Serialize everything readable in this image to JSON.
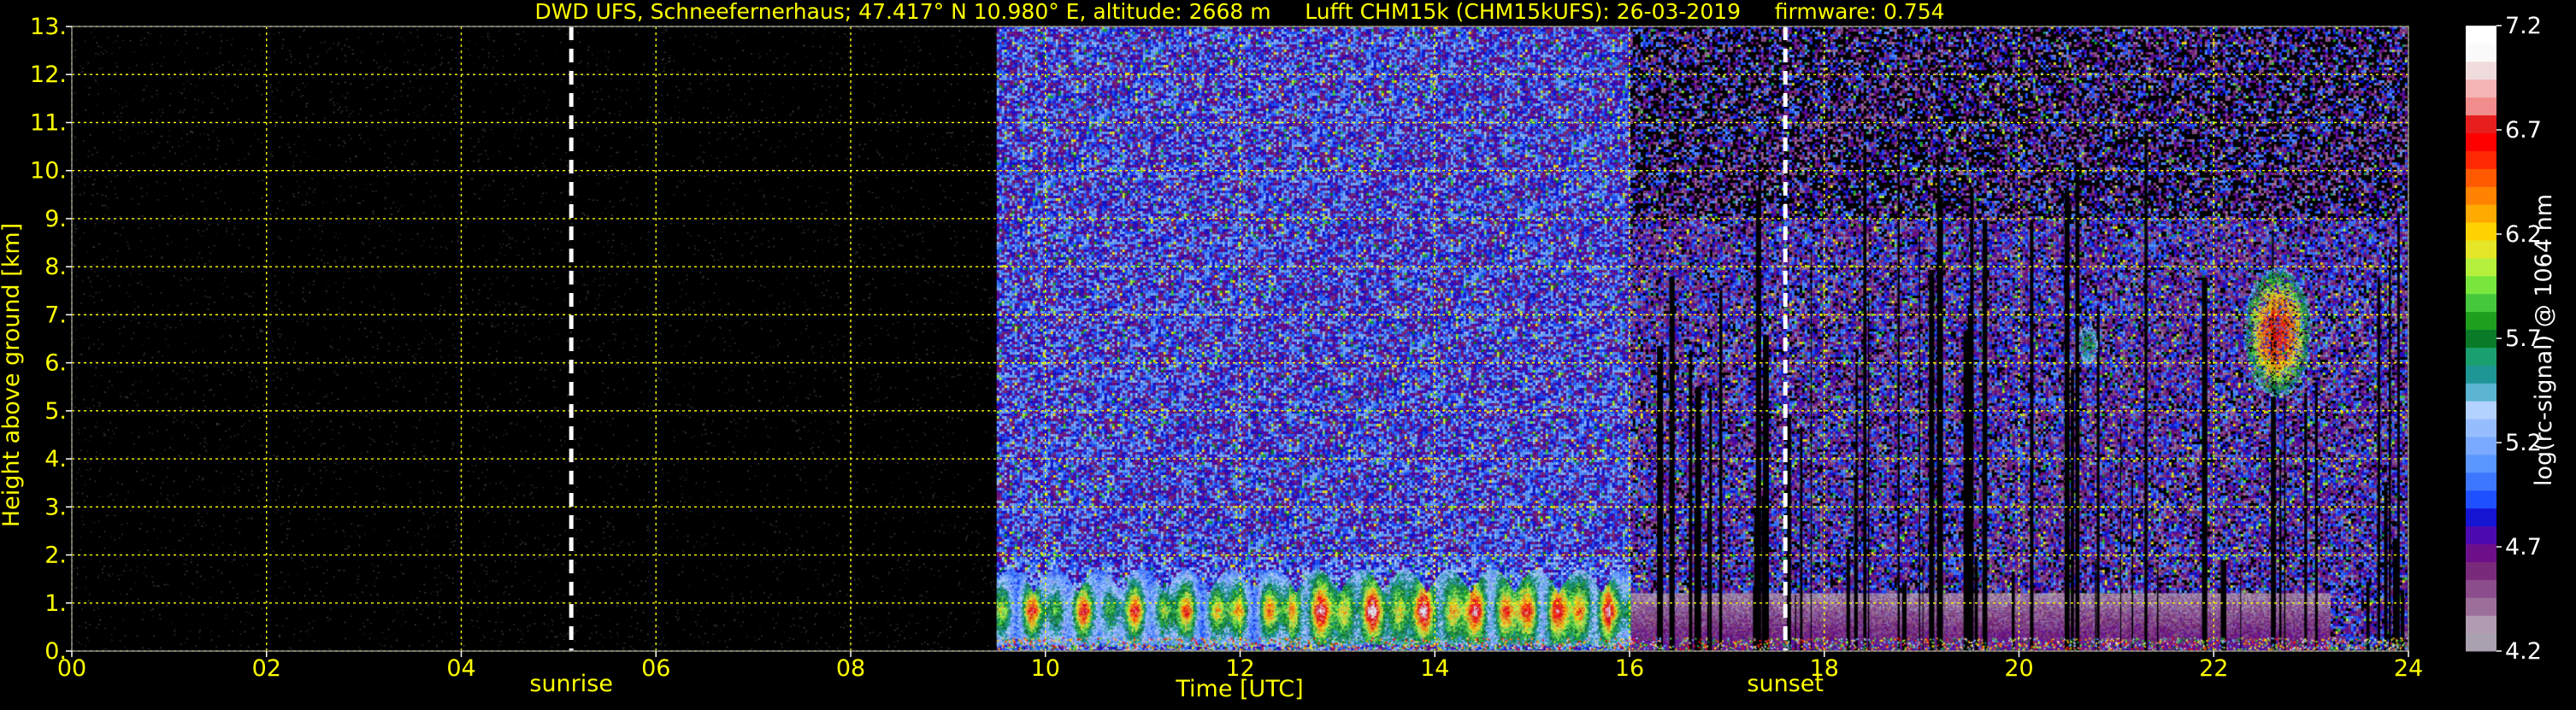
{
  "chart_data": {
    "type": "heatmap",
    "title": "DWD UFS, Schneefernerhaus; 47.417° N 10.980° E, altitude: 2668 m     Lufft CHM15k (CHM15kUFS): 26-03-2019     firmware: 0.754",
    "xlabel": "Time [UTC]",
    "ylabel": "Height above ground [km]",
    "colorbar_label": "log(rc-signal) @ 1064 nm",
    "xlim": [
      0,
      24
    ],
    "ylim": [
      0,
      13
    ],
    "x_ticks": [
      "00",
      "02",
      "04",
      "06",
      "08",
      "10",
      "12",
      "14",
      "16",
      "18",
      "20",
      "22",
      "24"
    ],
    "y_ticks": [
      "0.",
      "1.",
      "2.",
      "3.",
      "4.",
      "5.",
      "6.",
      "7.",
      "8.",
      "9.",
      "10.",
      "11.",
      "12.",
      "13."
    ],
    "colorbar_range": [
      4.2,
      7.2
    ],
    "colorbar_ticks": [
      "4.2",
      "4.7",
      "5.2",
      "5.7",
      "6.2",
      "6.7",
      "7.2"
    ],
    "grid": true,
    "grid_color": "#ffff00",
    "text_color": "#ffff00",
    "markers": [
      {
        "label": "sunrise",
        "time": 5.13
      },
      {
        "label": "sunset",
        "time": 17.6
      }
    ],
    "regions": [
      {
        "name": "night, no signal",
        "t_start": 0,
        "t_end": 9.5,
        "level": 4.2
      },
      {
        "name": "daylight background noise",
        "t_start": 9.5,
        "t_end": 16.0,
        "z_top": 13,
        "level": 5.0
      },
      {
        "name": "low cloud layer",
        "t_start": 9.5,
        "t_end": 16.0,
        "z_bottom": 0.2,
        "z_top": 1.8,
        "level": 6.6
      },
      {
        "name": "evening background",
        "t_start": 16.0,
        "t_end": 24,
        "z_top": 13,
        "level": 4.8
      },
      {
        "name": "boundary layer",
        "t_start": 16.0,
        "t_end": 23.2,
        "z_bottom": 0,
        "z_top": 1.2,
        "level": 4.6
      },
      {
        "name": "mid-level cloud",
        "t_start": 20.6,
        "t_end": 20.8,
        "z_bottom": 6.0,
        "z_top": 6.8,
        "level": 5.5
      },
      {
        "name": "mid-level cloud",
        "t_start": 22.3,
        "t_end": 23.0,
        "z_bottom": 5.3,
        "z_top": 8.0,
        "level": 6.3
      }
    ],
    "colorscale": [
      "#a9a0b0",
      "#b19bb2",
      "#9c6f9a",
      "#8b4d8b",
      "#7a2a7a",
      "#6e0f8a",
      "#4b0ab0",
      "#1414d2",
      "#1e50ff",
      "#3c78ff",
      "#5a96ff",
      "#7aaaff",
      "#96beff",
      "#b4d2ff",
      "#5ab4d2",
      "#1e9696",
      "#1aa06e",
      "#0a7a28",
      "#1ea01e",
      "#46c83c",
      "#78e63c",
      "#b4f03c",
      "#e6e628",
      "#ffd200",
      "#ffaa00",
      "#ff8200",
      "#ff5a00",
      "#ff2800",
      "#ff0000",
      "#e61e1e",
      "#f08c8c",
      "#f5b4b4",
      "#f0dcdc",
      "#fafafa",
      "#ffffff"
    ]
  }
}
